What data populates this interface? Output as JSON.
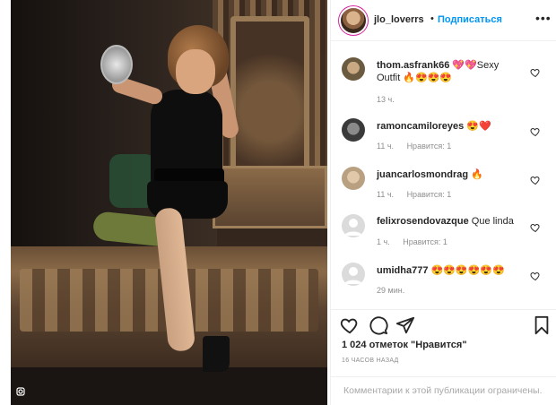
{
  "header": {
    "username": "jlo_loverrs",
    "separator": "•",
    "follow_label": "Подписаться",
    "more_label": "•••"
  },
  "comments": [
    {
      "username": "thom.asfrank66",
      "text": "💖💖Sexy Outfit 🔥😍😍😍",
      "time": "13 ч.",
      "likes": ""
    },
    {
      "username": "ramoncamiloreyes",
      "text": "😍❤️",
      "time": "11 ч.",
      "likes": "Нравится: 1"
    },
    {
      "username": "juancarlosmondrag",
      "text": "🔥",
      "time": "11 ч.",
      "likes": "Нравится: 1"
    },
    {
      "username": "felixrosendovazque",
      "text": "Que linda",
      "time": "1 ч.",
      "likes": "Нравится: 1"
    },
    {
      "username": "umidha777",
      "text": "😍😍😍😍😍😍",
      "time": "29 мин.",
      "likes": ""
    }
  ],
  "post": {
    "likes_text": "1 024 отметок \"Нравится\"",
    "timestamp": "16 ЧАСОВ НАЗАД",
    "comments_limited": "Комментарии к этой публикации ограничены."
  },
  "icons": {
    "like": "heart-icon",
    "comment": "comment-icon",
    "share": "share-icon",
    "save": "bookmark-icon",
    "photo_badge": "instagram-mark-icon"
  },
  "colors": {
    "accent": "#0095f6",
    "muted": "#8e8e8e",
    "border": "#efefef"
  }
}
